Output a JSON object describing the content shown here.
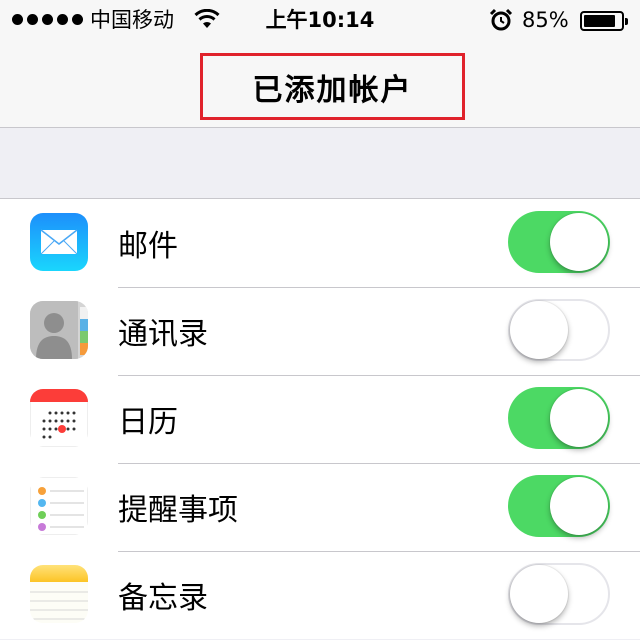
{
  "status_bar": {
    "carrier": "中国移动",
    "time": "上午10:14",
    "battery_percent": "85%",
    "battery_level": 0.85,
    "icons": [
      "signal-dots",
      "wifi-icon",
      "alarm-icon",
      "battery-icon"
    ]
  },
  "nav": {
    "title": "已添加帐户",
    "highlight_color": "#e0222b"
  },
  "colors": {
    "switch_on": "#4cd964",
    "background": "#efeff4"
  },
  "items": [
    {
      "label": "邮件",
      "icon": "mail-icon",
      "enabled": true
    },
    {
      "label": "通讯录",
      "icon": "contacts-icon",
      "enabled": false
    },
    {
      "label": "日历",
      "icon": "calendar-icon",
      "enabled": true
    },
    {
      "label": "提醒事项",
      "icon": "reminders-icon",
      "enabled": true
    },
    {
      "label": "备忘录",
      "icon": "notes-icon",
      "enabled": false
    }
  ]
}
